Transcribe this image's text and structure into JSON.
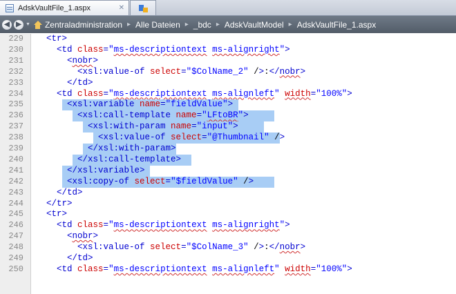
{
  "tabs": [
    {
      "label": "AdskVaultFile_1.aspx",
      "icon": "document-icon",
      "active": true
    },
    {
      "label": "",
      "icon": "site-icon",
      "active": false
    }
  ],
  "nav": {
    "breadcrumbs": [
      "Zentraladministration",
      "Alle Dateien",
      "_bdc",
      "AdskVaultModel",
      "AdskVaultFile_1.aspx"
    ]
  },
  "colors": {
    "selection": "#a8cdf5",
    "tag": "#0000d0",
    "attribute": "#cc0000",
    "value": "#0000ff",
    "gutter": "#eeeeee"
  },
  "code_lines": [
    {
      "n": "229",
      "text": "<tr>"
    },
    {
      "n": "230",
      "text": "<td class=\"ms-descriptiontext ms-alignright\">"
    },
    {
      "n": "231",
      "text": "<nobr>"
    },
    {
      "n": "232",
      "text": "<xsl:value-of select=\"$ColName_2\" />:</nobr>"
    },
    {
      "n": "233",
      "text": "</td>"
    },
    {
      "n": "234",
      "text": "<td class=\"ms-descriptiontext ms-alignleft\" width=\"100%\">"
    },
    {
      "n": "235",
      "text": "<xsl:variable name=\"fieldValue\">"
    },
    {
      "n": "236",
      "text": "<xsl:call-template name=\"LFtoBR\">"
    },
    {
      "n": "237",
      "text": "<xsl:with-param name=\"input\">"
    },
    {
      "n": "238",
      "text": "<xsl:value-of select=\"@Thumbnail\" />"
    },
    {
      "n": "239",
      "text": "</xsl:with-param>"
    },
    {
      "n": "240",
      "text": "</xsl:call-template>"
    },
    {
      "n": "241",
      "text": "</xsl:variable>"
    },
    {
      "n": "242",
      "text": "<xsl:copy-of select=\"$fieldValue\" />"
    },
    {
      "n": "243",
      "text": "</td>"
    },
    {
      "n": "244",
      "text": "</tr>"
    },
    {
      "n": "245",
      "text": "<tr>"
    },
    {
      "n": "246",
      "text": "<td class=\"ms-descriptiontext ms-alignright\">"
    },
    {
      "n": "247",
      "text": "<nobr>"
    },
    {
      "n": "248",
      "text": "<xsl:value-of select=\"$ColName_3\" />:</nobr>"
    },
    {
      "n": "249",
      "text": "</td>"
    },
    {
      "n": "250",
      "text": "<td class=\"ms-descriptiontext ms-alignleft\" width=\"100%\">"
    }
  ]
}
